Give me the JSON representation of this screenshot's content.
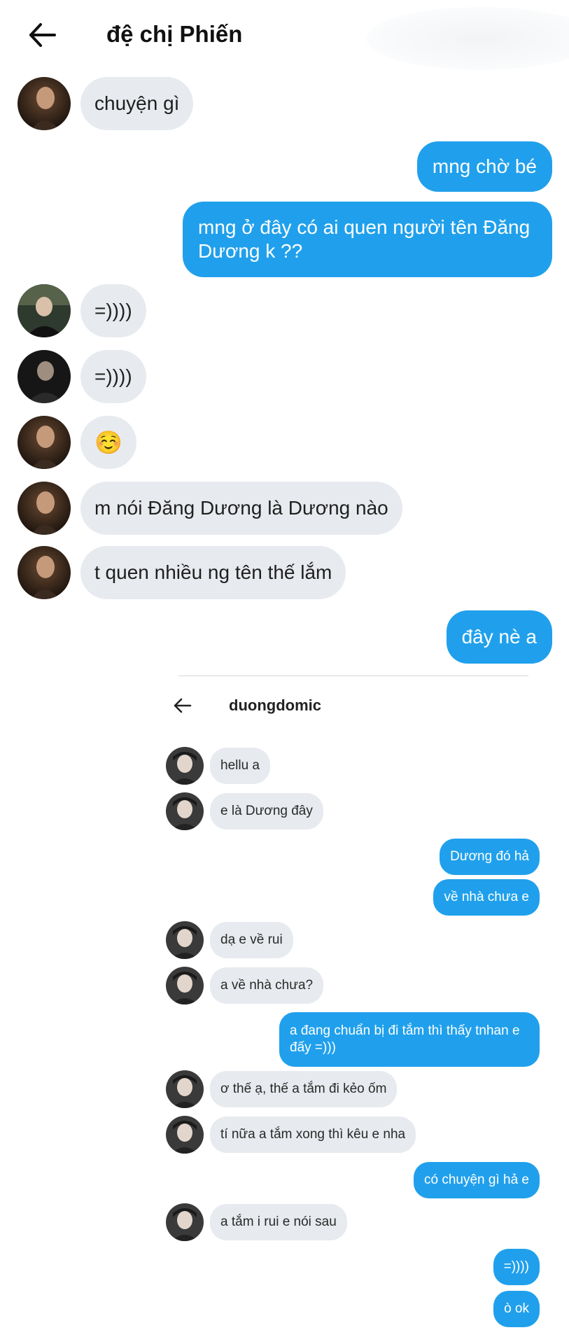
{
  "header": {
    "title": "đệ chị Phiến",
    "back_icon": "arrow-left-icon"
  },
  "colors": {
    "incoming_bubble": "#e7eaee",
    "outgoing_bubble": "#20a0ec",
    "outgoing_text": "#ffffff"
  },
  "messages": [
    {
      "side": "in",
      "text": "chuyện gì"
    },
    {
      "side": "out",
      "text": "mng chờ bé"
    },
    {
      "side": "out",
      "text": "mng ở đây có ai quen người tên Đăng Dương k ??"
    },
    {
      "side": "in",
      "text": "=))))"
    },
    {
      "side": "in",
      "text": "=))))"
    },
    {
      "side": "in",
      "text": "☺️"
    },
    {
      "side": "in",
      "text": "m nói Đăng Dương là Dương nào"
    },
    {
      "side": "in",
      "text": "t quen nhiều ng tên thế lắm"
    },
    {
      "side": "out",
      "text": "đây nè a"
    }
  ],
  "embedded_screenshot": {
    "title": "duongdomic",
    "back_icon": "arrow-left-icon",
    "messages": [
      {
        "side": "in",
        "text": "hellu a"
      },
      {
        "side": "in",
        "text": "e là Dương đây"
      },
      {
        "side": "out",
        "text": "Dương đó hả"
      },
      {
        "side": "out",
        "text": "về nhà chưa e"
      },
      {
        "side": "in",
        "text": "dạ e về rui"
      },
      {
        "side": "in",
        "text": "a về nhà chưa?"
      },
      {
        "side": "out",
        "text": "a đang chuẩn bị đi tắm thì thấy tnhan e đấy =)))"
      },
      {
        "side": "in",
        "text": "ơ thế ạ, thế a tắm đi kẻo ốm"
      },
      {
        "side": "in",
        "text": "tí nữa a tắm xong thì kêu e nha"
      },
      {
        "side": "out",
        "text": "có chuyện gì hả e"
      },
      {
        "side": "in",
        "text": "a tắm i rui e nói sau"
      },
      {
        "side": "out",
        "text": "=))))"
      },
      {
        "side": "out",
        "text": "ò ok"
      }
    ]
  }
}
